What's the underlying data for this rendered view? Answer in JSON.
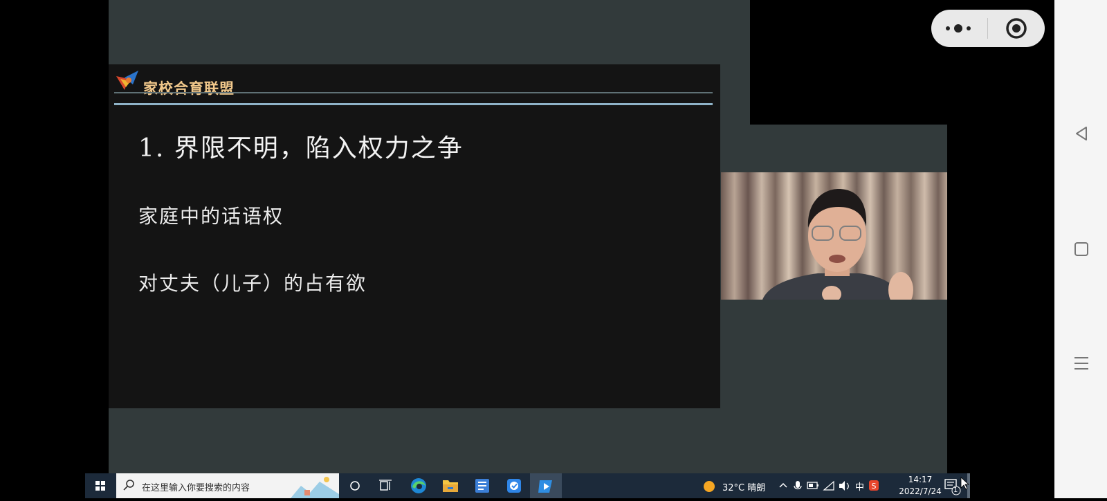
{
  "slide": {
    "logo_text": "家校合育联盟",
    "title": "1. 界限不明，陷入权力之争",
    "bullets": [
      "家庭中的话语权",
      "对丈夫（儿子）的占有欲"
    ]
  },
  "taskbar": {
    "search_placeholder": "在这里输入你要搜索的内容",
    "weather": "32°C  晴朗",
    "ime": "中",
    "time": "14:17",
    "date": "2022/7/24",
    "notification_count": "1"
  },
  "colors": {
    "screen_bg": "#323a3b",
    "slide_bg": "#141414",
    "logo_text": "#f2c98c",
    "taskbar_bg": "#1c2a3a"
  },
  "icons": [
    "windows-start-icon",
    "search-icon",
    "cortana-icon",
    "task-view-icon",
    "edge-icon",
    "file-explorer-icon",
    "document-app-icon",
    "checkbox-app-icon",
    "media-player-icon",
    "weather-sun-icon",
    "chevron-up-icon",
    "microphone-icon",
    "battery-icon",
    "wifi-icon",
    "volume-icon",
    "sogou-ime-icon",
    "notification-icon",
    "more-dots-icon",
    "target-close-icon",
    "back-triangle-icon",
    "home-square-icon",
    "menu-lines-icon"
  ]
}
